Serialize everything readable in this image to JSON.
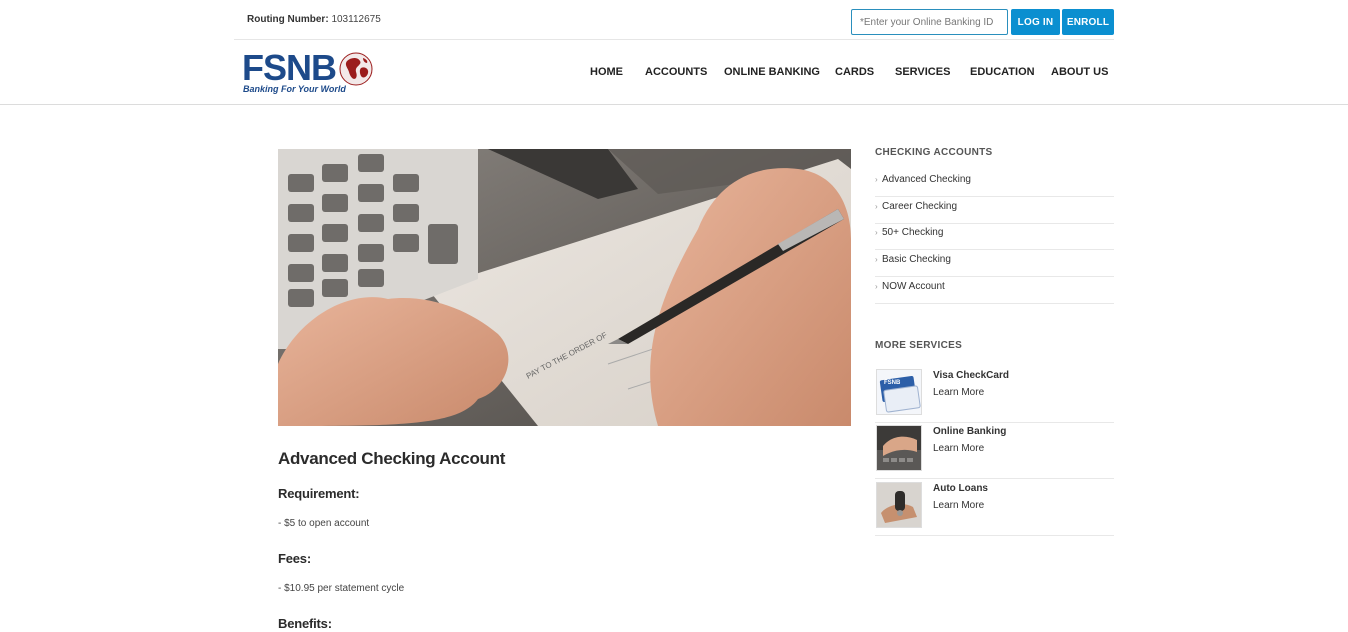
{
  "topbar": {
    "routing_label": "Routing Number:",
    "routing_value": "103112675",
    "login_placeholder": "*Enter your Online Banking ID",
    "login_button": "LOG IN",
    "enroll_button": "ENROLL"
  },
  "logo": {
    "text": "FSNB",
    "tagline": "Banking For Your World"
  },
  "nav": {
    "items": [
      "HOME",
      "ACCOUNTS",
      "ONLINE BANKING",
      "CARDS",
      "SERVICES",
      "EDUCATION",
      "ABOUT US"
    ]
  },
  "main": {
    "title": "Advanced Checking Account",
    "sections": [
      {
        "heading": "Requirement:",
        "text": "- $5 to open account"
      },
      {
        "heading": "Fees:",
        "text": "- $10.95 per statement cycle"
      },
      {
        "heading": "Benefits:",
        "text": ""
      }
    ]
  },
  "sidebar": {
    "checking_heading": "CHECKING ACCOUNTS",
    "checking_links": [
      "Advanced Checking",
      "Career Checking",
      "50+ Checking",
      "Basic Checking",
      "NOW Account"
    ],
    "services_heading": "MORE SERVICES",
    "services": [
      {
        "title": "Visa CheckCard",
        "link": "Learn More"
      },
      {
        "title": "Online Banking",
        "link": "Learn More"
      },
      {
        "title": "Auto Loans",
        "link": "Learn More"
      }
    ]
  },
  "colors": {
    "brand_blue": "#1d4a8a",
    "button_blue": "#0b8fd0",
    "logo_red": "#9b1c1c"
  }
}
